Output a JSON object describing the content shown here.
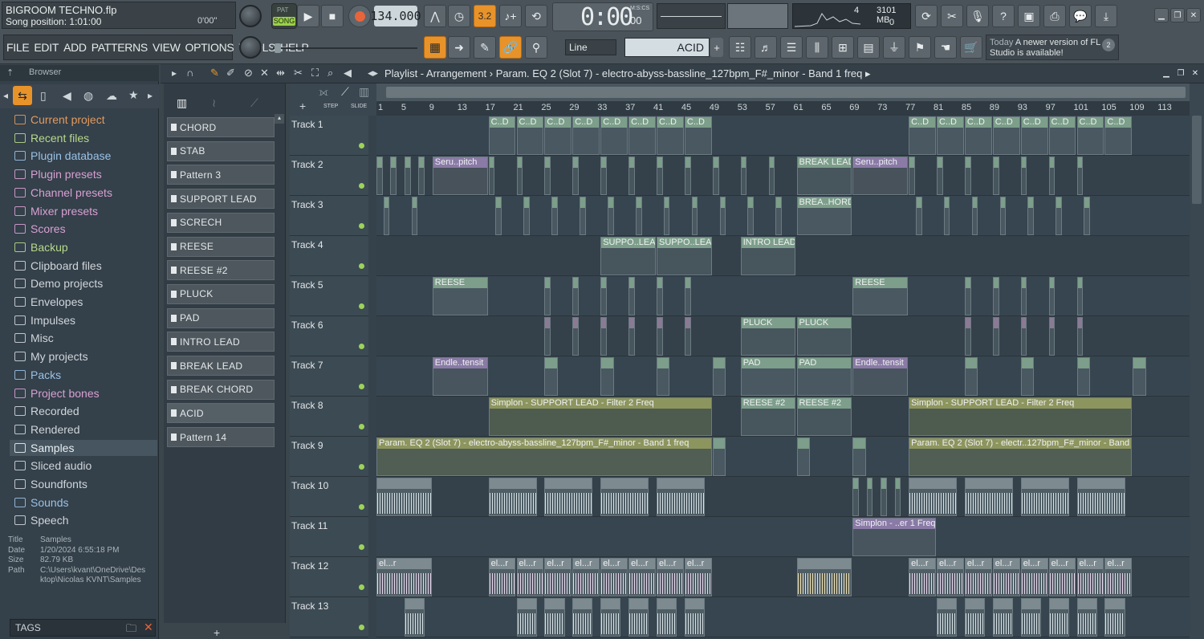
{
  "project": {
    "filename": "BIGROOM TECHNO.flp",
    "song_position": "Song position: 1:01:00",
    "time_small": "0'00\""
  },
  "transport": {
    "pat_label": "PAT",
    "song_label": "SONG",
    "tempo": "134.000",
    "time": "0:00",
    "time_sub": "00",
    "time_format": "M:S:CS",
    "beat_label": "3.2",
    "mem": "3101 MB",
    "cpu_num": "4",
    "voices": "0"
  },
  "menu": [
    "FILE",
    "EDIT",
    "ADD",
    "PATTERNS",
    "VIEW",
    "OPTIONS",
    "TOOLS",
    "HELP"
  ],
  "toolbar": {
    "snap": "Line",
    "pattern_name": "ACID",
    "news_today": "Today",
    "news_text": "A newer version of FL Studio is available!",
    "news_badge": "2"
  },
  "browser": {
    "title": "Browser",
    "items": [
      {
        "label": "Current project",
        "color": "#e39a5c"
      },
      {
        "label": "Recent files",
        "color": "#b7d98a"
      },
      {
        "label": "Plugin database",
        "color": "#9ac2e6"
      },
      {
        "label": "Plugin presets",
        "color": "#d8a0d2"
      },
      {
        "label": "Channel presets",
        "color": "#d8a0d2"
      },
      {
        "label": "Mixer presets",
        "color": "#d8a0d2"
      },
      {
        "label": "Scores",
        "color": "#d8a0d2"
      },
      {
        "label": "Backup",
        "color": "#b7d98a"
      },
      {
        "label": "Clipboard files",
        "color": "#cfd6da"
      },
      {
        "label": "Demo projects",
        "color": "#cfd6da"
      },
      {
        "label": "Envelopes",
        "color": "#cfd6da"
      },
      {
        "label": "Impulses",
        "color": "#cfd6da"
      },
      {
        "label": "Misc",
        "color": "#cfd6da"
      },
      {
        "label": "My projects",
        "color": "#cfd6da"
      },
      {
        "label": "Packs",
        "color": "#9ac2e6"
      },
      {
        "label": "Project bones",
        "color": "#d8a0d2"
      },
      {
        "label": "Recorded",
        "color": "#cfd6da"
      },
      {
        "label": "Rendered",
        "color": "#cfd6da"
      },
      {
        "label": "Samples",
        "color": "#e8eef0"
      },
      {
        "label": "Sliced audio",
        "color": "#cfd6da"
      },
      {
        "label": "Soundfonts",
        "color": "#cfd6da"
      },
      {
        "label": "Sounds",
        "color": "#9ac2e6"
      },
      {
        "label": "Speech",
        "color": "#cfd6da"
      }
    ],
    "info": {
      "title_k": "Title",
      "title_v": "Samples",
      "date_k": "Date",
      "date_v": "1/20/2024 6:55:18 PM",
      "size_k": "Size",
      "size_v": "82.79 KB",
      "path_k": "Path",
      "path_v": "C:\\Users\\kvant\\OneDrive\\Desktop\\Nicolas KVNT\\Samples"
    },
    "tags": "TAGS"
  },
  "patterns": [
    "CHORD",
    "STAB",
    "Pattern 3",
    "SUPPORT LEAD",
    "SCRECH",
    "REESE",
    "REESE #2",
    "PLUCK",
    "PAD",
    "INTRO LEAD",
    "BREAK LEAD",
    "BREAK CHORD",
    "ACID",
    "Pattern 14"
  ],
  "playlist": {
    "title": "Playlist - Arrangement",
    "crumb": "Param. EQ 2 (Slot 7) - electro-abyss-bassline_127bpm_F#_minor - Band 1 freq",
    "step": "STEP",
    "slide": "SLIDE",
    "ruler": [
      "1",
      "5",
      "9",
      "13",
      "17",
      "21",
      "25",
      "29",
      "33",
      "37",
      "41",
      "45",
      "49",
      "53",
      "57",
      "61",
      "65",
      "69",
      "73",
      "77",
      "81",
      "85",
      "89",
      "93",
      "97",
      "101",
      "105",
      "109",
      "113"
    ],
    "tracks": [
      "Track 1",
      "Track 2",
      "Track 3",
      "Track 4",
      "Track 5",
      "Track 6",
      "Track 7",
      "Track 8",
      "Track 9",
      "Track 10",
      "Track 11",
      "Track 12",
      "Track 13"
    ],
    "clips": {
      "cd": "C..D",
      "seru": "Seru..pitch",
      "break_lead": "BREAK LEAD",
      "brea_hord": "BREA..HORD",
      "suppo_lead": "SUPPO..LEAD",
      "intro_lead": "INTRO LEAD",
      "reese": "REESE",
      "pluck": "PLUCK",
      "endle": "Endle..tensit",
      "pad": "PAD",
      "simplon_support": "Simplon - SUPPORT LEAD - Filter 2 Freq",
      "reese2": "REESE #2",
      "param_eq": "Param. EQ 2 (Slot 7) - electro-abyss-bassline_127bpm_F#_minor - Band 1 freq",
      "param_eq_short": "Param. EQ 2 (Slot 7) - electr..127bpm_F#_minor - Band 1 freq",
      "simplon_filter": "Simplon - ..er 1 Freq",
      "elr": "el...r"
    }
  }
}
